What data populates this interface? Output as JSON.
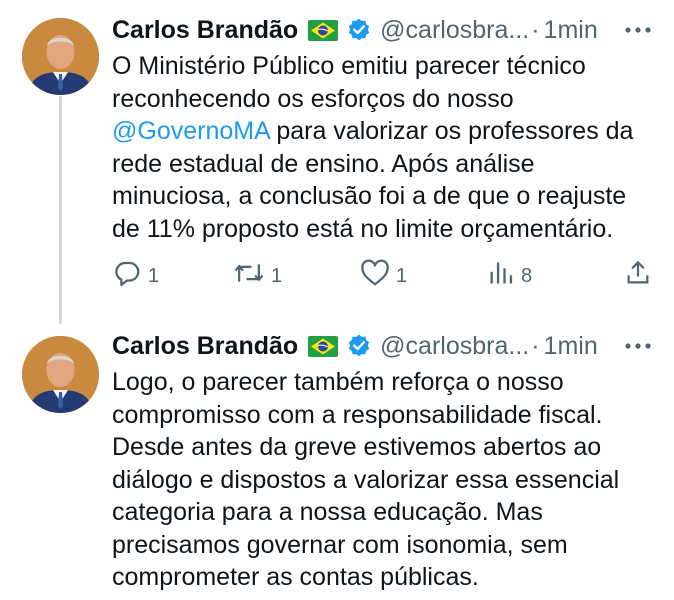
{
  "tweets": [
    {
      "name": "Carlos Brandão",
      "handle": "@carlosbra...",
      "separator": "·",
      "time": "1min",
      "text_before": "O Ministério Público emitiu parecer técnico reconhecendo os esforços do nosso ",
      "mention": "@GovernoMA",
      "text_after": " para valorizar os professores da rede estadual de ensino. Após análise minuciosa, a conclusão foi a de que o reajuste de 11%  proposto está no limite orçamentário.",
      "counts": {
        "replies": "1",
        "retweets": "1",
        "likes": "1",
        "views": "8"
      }
    },
    {
      "name": "Carlos Brandão",
      "handle": "@carlosbra...",
      "separator": "·",
      "time": "1min",
      "text": "Logo, o parecer também reforça o nosso compromisso com a responsabilidade fiscal. Desde antes da greve estivemos abertos ao diálogo e dispostos a valorizar essa essencial categoria para a nossa educação. Mas precisamos governar com isonomia, sem comprometer as contas públicas."
    }
  ],
  "icons": {
    "flag": "brazil-flag-icon",
    "verified": "verified-badge-icon",
    "more": "more-options-icon",
    "reply": "reply-icon",
    "retweet": "retweet-icon",
    "like": "heart-icon",
    "views": "views-icon",
    "share": "share-icon"
  },
  "colors": {
    "accent": "#1d9bf0",
    "secondary_text": "#536471",
    "thread_line": "#cfd9de"
  }
}
